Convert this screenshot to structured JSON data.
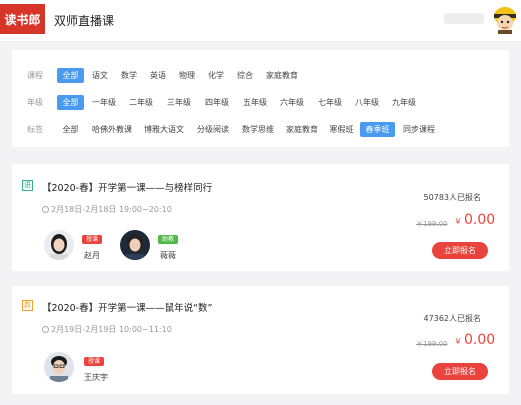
{
  "header": {
    "logo": "读书郎",
    "title": "双师直播课",
    "avatar_icon": "cartoon-avatar-icon"
  },
  "filters": {
    "course": {
      "label": "课程",
      "options": [
        "全部",
        "语文",
        "数学",
        "英语",
        "物理",
        "化学",
        "综合",
        "家庭教育"
      ],
      "selected": "全部"
    },
    "grade": {
      "label": "年级",
      "options": [
        "全部",
        "一年级",
        "二年级",
        "三年级",
        "四年级",
        "五年级",
        "六年级",
        "七年级",
        "八年级",
        "九年级"
      ],
      "selected": "全部"
    },
    "tag": {
      "label": "标签",
      "options": [
        "全部",
        "哈佛外教课",
        "博雅大语文",
        "分级阅读",
        "数学思维",
        "家庭教育",
        "寒假班",
        "春季班",
        "同步课程"
      ],
      "selected": "春季班"
    }
  },
  "courses": [
    {
      "subject_tag": "语",
      "title": "【2020-春】开学第一课——与榜样同行",
      "time": "2月18日-2月18日 19:00~20:10",
      "enrolled": "50783人已报名",
      "original_price": "￥199.00",
      "price_symbol": "￥",
      "price": "0.00",
      "signup_label": "立即报名",
      "teachers": [
        {
          "role": "授课",
          "name": "赵月"
        },
        {
          "role": "助教",
          "name": "薇薇"
        }
      ]
    },
    {
      "subject_tag": "数",
      "title": "【2020-春】开学第一课——鼠年说“数”",
      "time": "2月19日-2月19日 10:00~11:10",
      "enrolled": "47362人已报名",
      "original_price": "￥199.00",
      "price_symbol": "￥",
      "price": "0.00",
      "signup_label": "立即报名",
      "teachers": [
        {
          "role": "授课",
          "name": "王庆宇"
        }
      ]
    }
  ],
  "colors": {
    "brand_red": "#d8352a",
    "active_blue": "#4a9bef",
    "price_red": "#e8433c",
    "teach_badge": "#e8433c",
    "assist_badge": "#53b84a",
    "chinese_tag": "#3bb28f",
    "math_tag": "#f0a030"
  }
}
